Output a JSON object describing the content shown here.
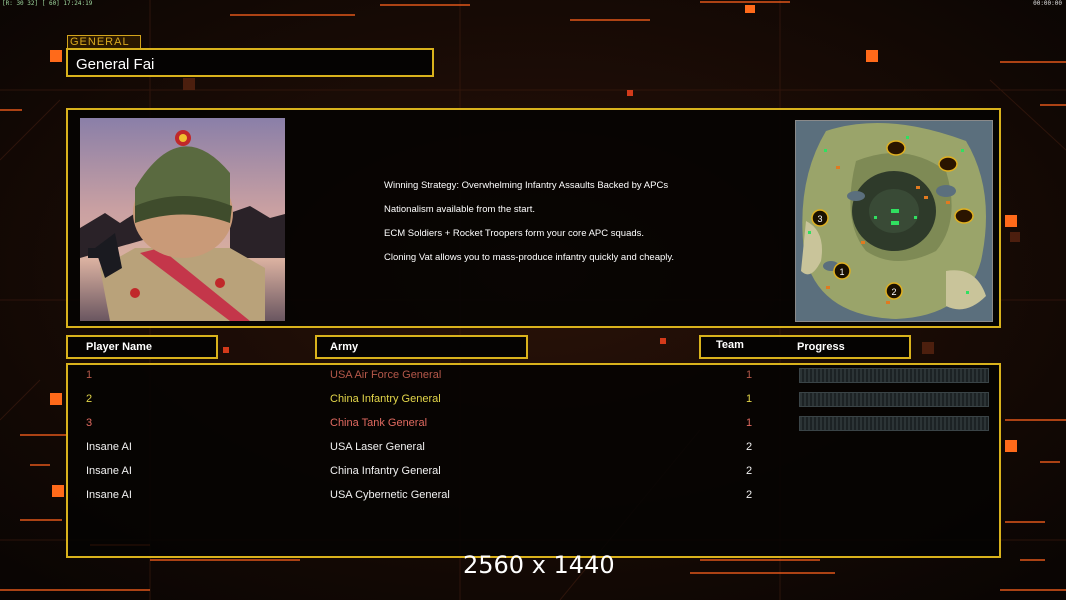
{
  "status_bar": {
    "left": "[R: 30 32] [ 60] 17:24:19",
    "right": "00:00:00"
  },
  "general": {
    "tab_label": "GENERAL",
    "name": "General Fai"
  },
  "description": [
    "Winning Strategy: Overwhelming Infantry Assaults Backed by APCs",
    "Nationalism available from the start.",
    "ECM Soldiers + Rocket Troopers form your core APC squads.",
    "Cloning Vat allows you to mass-produce infantry quickly and cheaply."
  ],
  "headers": {
    "player_name": "Player Name",
    "army": "Army",
    "team": "Team",
    "progress": "Progress"
  },
  "players": [
    {
      "name": "1",
      "army": "USA Air Force General",
      "team": "1",
      "color": "#b5584a",
      "has_progress": true,
      "progress": 0
    },
    {
      "name": "2",
      "army": "China Infantry General",
      "team": "1",
      "color": "#e3d64a",
      "has_progress": true,
      "progress": 0
    },
    {
      "name": "3",
      "army": "China Tank General",
      "team": "1",
      "color": "#e06a60",
      "has_progress": true,
      "progress": 0
    },
    {
      "name": "Insane AI",
      "army": "USA Laser General",
      "team": "2",
      "color": "#f2f2f2",
      "has_progress": false
    },
    {
      "name": "Insane AI",
      "army": "China Infantry General",
      "team": "2",
      "color": "#f2f2f2",
      "has_progress": false
    },
    {
      "name": "Insane AI",
      "army": "USA Cybernetic General",
      "team": "2",
      "color": "#f2f2f2",
      "has_progress": false
    }
  ],
  "minimap": {
    "start_positions": [
      "3",
      "1",
      "2"
    ]
  },
  "resolution_text": "2560 x 1440",
  "colors": {
    "accent": "#d9b21c",
    "background": "#0d0705",
    "glow": "#ff6a1a"
  }
}
